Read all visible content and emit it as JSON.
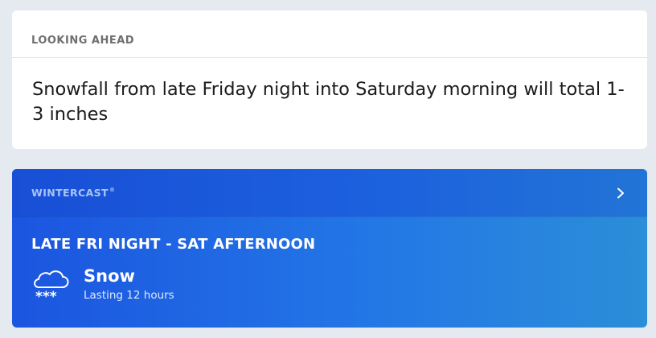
{
  "looking_ahead": {
    "heading": "LOOKING AHEAD",
    "text": "Snowfall from late Friday night into Saturday morning will total 1-3 inches"
  },
  "wintercast": {
    "brand": "WINTERCAST",
    "brand_mark": "®",
    "chevron_icon": "chevron-right-icon",
    "period": "LATE FRI NIGHT - SAT AFTERNOON",
    "condition": "Snow",
    "duration": "Lasting 12 hours",
    "condition_icon": "snow-cloud-icon",
    "colors": {
      "gradient_start": "#1b55e0",
      "gradient_end": "#2b8ed8",
      "brand_text": "#a9c4f6"
    }
  }
}
